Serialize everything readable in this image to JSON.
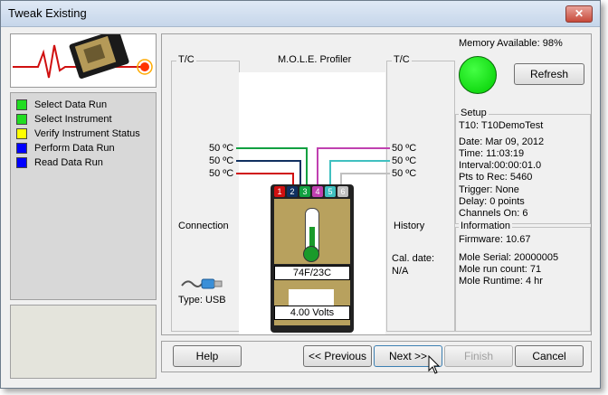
{
  "window": {
    "title": "Tweak Existing",
    "close_symbol": "✕"
  },
  "steps": [
    {
      "label": "Select Data Run",
      "color": "#22dd22"
    },
    {
      "label": "Select Instrument",
      "color": "#22dd22"
    },
    {
      "label": "Verify Instrument Status",
      "color": "#ffff00"
    },
    {
      "label": "Perform Data Run",
      "color": "#0000ff"
    },
    {
      "label": "Read Data Run",
      "color": "#0000ff"
    }
  ],
  "main": {
    "memory": "Memory Available: 98%",
    "refresh_label": "Refresh",
    "profiler_title": "M.O.L.E. Profiler",
    "tc_left": "T/C",
    "tc_right": "T/C",
    "left_temps": [
      "50 ºC",
      "50 ºC",
      "50 ºC"
    ],
    "right_temps": [
      "50 ºC",
      "50 ºC",
      "50 ºC"
    ],
    "connection_label": "Connection",
    "connection_type": "Type: USB",
    "history_label": "History",
    "cal_date_label": "Cal. date:",
    "cal_date_value": "N/A",
    "device_temp": "74F/23C",
    "device_volts": "4.00 Volts",
    "channels": [
      "1",
      "2",
      "3",
      "4",
      "5",
      "6"
    ],
    "setup": {
      "label": "Setup",
      "name": "T10: T10DemoTest",
      "date": "Date: Mar 09, 2012",
      "time": "Time:  11:03:19",
      "interval": "Interval:00:00:01.0",
      "pts": "Pts to Rec: 5460",
      "trigger": "Trigger: None",
      "delay": "Delay: 0 points",
      "channels_on": "Channels On: 6"
    },
    "information": {
      "label": "Information",
      "firmware": "Firmware: 10.67",
      "serial": "Mole Serial: 20000005",
      "run_count": "Mole run count: 71",
      "runtime": "Mole Runtime: 4 hr"
    }
  },
  "buttons": {
    "help": "Help",
    "previous": "<< Previous",
    "next": "Next >>",
    "finish": "Finish",
    "cancel": "Cancel"
  }
}
